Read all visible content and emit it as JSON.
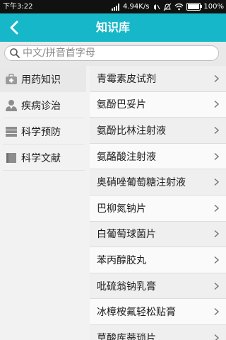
{
  "status": {
    "time": "下午3:22",
    "speed": "4.94K/s",
    "battery": "100%"
  },
  "header": {
    "title": "知识库",
    "accent": "#16b7c9"
  },
  "search": {
    "placeholder": "中文/拼音首字母"
  },
  "categories": [
    {
      "label": "用药知识",
      "icon": "medicine-kit-icon",
      "active": true
    },
    {
      "label": "疾病诊治",
      "icon": "doctor-icon",
      "active": false
    },
    {
      "label": "科学预防",
      "icon": "stack-icon",
      "active": false
    },
    {
      "label": "科学文献",
      "icon": "book-icon",
      "active": false
    }
  ],
  "items": [
    "青霉素皮试剂",
    "氨酚巴妥片",
    "氨酚比林注射液",
    "氨酪酸注射液",
    "奥硝唑葡萄糖注射液",
    "巴柳氮钠片",
    "白葡萄球菌片",
    "苯丙醇胶丸",
    "吡硫翁钠乳膏",
    "冰樟桉氟轻松贴膏",
    "草酸库蒂琐片"
  ]
}
